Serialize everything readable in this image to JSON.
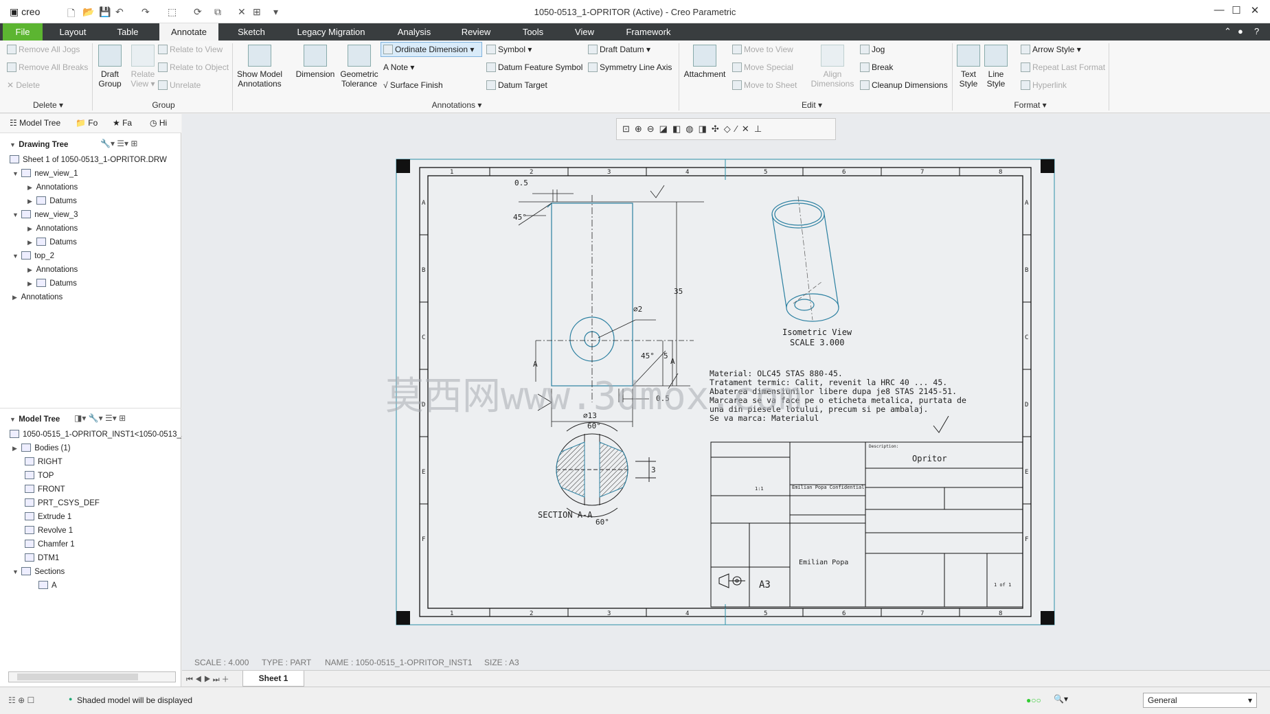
{
  "app": {
    "logo": "creo",
    "window_title": "1050-0513_1-OPRITOR (Active) - Creo Parametric"
  },
  "icons": {
    "new": "new-file-icon",
    "open": "open-folder-icon",
    "save": "save-icon",
    "undo": "undo-icon",
    "redo": "redo-icon",
    "minimize": "minimize-icon",
    "maximize": "maximize-icon",
    "close": "close-icon"
  },
  "menu": {
    "tabs": [
      "File",
      "Layout",
      "Table",
      "Annotate",
      "Sketch",
      "Legacy Migration",
      "Analysis",
      "Review",
      "Tools",
      "View",
      "Framework"
    ],
    "active": "Annotate"
  },
  "ribbon": {
    "delete": {
      "remove_all_jogs": "Remove All Jogs",
      "remove_all_breaks": "Remove All Breaks",
      "delete": "Delete",
      "group": "Delete ▾"
    },
    "group": {
      "draft_group": "Draft Group",
      "relate_view": "Relate View ▾",
      "relate_to_view": "Relate to View",
      "relate_to_object": "Relate to Object",
      "unrelate": "Unrelate",
      "group": "Group"
    },
    "annotations": {
      "show_model": "Show Model Annotations",
      "dimension": "Dimension",
      "geometric_tolerance": "Geometric Tolerance",
      "ordinate_dimension": "Ordinate Dimension",
      "note": "Note",
      "surface_finish": "Surface Finish",
      "symbol": "Symbol",
      "datum_feature_symbol": "Datum Feature Symbol",
      "datum_target": "Datum Target",
      "draft_datum": "Draft Datum",
      "symmetry_line_axis": "Symmetry Line Axis",
      "group": "Annotations ▾"
    },
    "edit": {
      "attachment": "Attachment",
      "move_to_view": "Move to View",
      "move_special": "Move Special",
      "move_to_sheet": "Move to Sheet",
      "align_dimensions": "Align Dimensions",
      "jog": "Jog",
      "break": "Break",
      "cleanup_dimensions": "Cleanup Dimensions",
      "group": "Edit ▾"
    },
    "format": {
      "text_style": "Text Style",
      "line_style": "Line Style",
      "arrow_style": "Arrow Style",
      "repeat_last_format": "Repeat Last Format",
      "hyperlink": "Hyperlink",
      "group": "Format ▾"
    }
  },
  "left_tabs": [
    "Model Tree",
    "Fo",
    "Fa",
    "Hi"
  ],
  "drawing_tree": {
    "title": "Drawing Tree",
    "rows": [
      "Sheet 1 of 1050-0513_1-OPRITOR.DRW",
      "new_view_1",
      "Annotations",
      "Datums",
      "new_view_3",
      "Annotations",
      "Datums",
      "top_2",
      "Annotations",
      "Datums",
      "Annotations"
    ]
  },
  "model_tree": {
    "title": "Model Tree",
    "rows": [
      "1050-0515_1-OPRITOR_INST1<1050-0513_1-",
      "Bodies (1)",
      "RIGHT",
      "TOP",
      "FRONT",
      "PRT_CSYS_DEF",
      "Extrude 1",
      "Revolve 1",
      "Chamfer 1",
      "DTM1",
      "Sections",
      "A"
    ]
  },
  "status": {
    "scale": "SCALE : 4.000",
    "type": "TYPE : PART",
    "name": "NAME : 1050-0515_1-OPRITOR_INST1",
    "size": "SIZE : A3"
  },
  "sheet_tab": "Sheet 1",
  "message": "Shaded model will be displayed",
  "filter": "General",
  "drawing": {
    "border_cols": [
      "1",
      "2",
      "3",
      "4",
      "5",
      "6",
      "7",
      "8"
    ],
    "border_rows": [
      "A",
      "B",
      "C",
      "D",
      "E",
      "F"
    ],
    "dims": {
      "d05_top": "0.5",
      "d45_top": "45°",
      "d35": "35",
      "d2": "⌀2",
      "d45_bot": "45°",
      "d5": "5",
      "d05_bot": "0.5",
      "d13": "⌀13",
      "d60_top": "60°",
      "d3": "3",
      "d60_bot": "60°",
      "sec_label_a1": "A",
      "sec_label_a2": "A"
    },
    "section_title": "SECTION A-A",
    "iso_title": "Isometric View",
    "iso_scale": "SCALE 3.000",
    "notes": [
      "Material: OLC45 STAS 880-45.",
      "Tratament termic: Calit, revenit la HRC 40 ... 45.",
      "Abaterea dimensiunilor libere dupa je8 STAS 2145-51.",
      "Marcarea se va face pe o eticheta metalica, purtata de",
      "una din piesele lotului, precum si pe ambalaj.",
      "Se va marca: Materialul"
    ],
    "title_block": {
      "description_label": "Description:",
      "description": "Opritor",
      "size": "A3",
      "designer": "Emilian Popa",
      "confidential": "Emilian Popa Confidential",
      "scale_val": "1:1",
      "sheet": "1 of 1"
    },
    "watermark": "莫西网www.3dmox.com"
  }
}
